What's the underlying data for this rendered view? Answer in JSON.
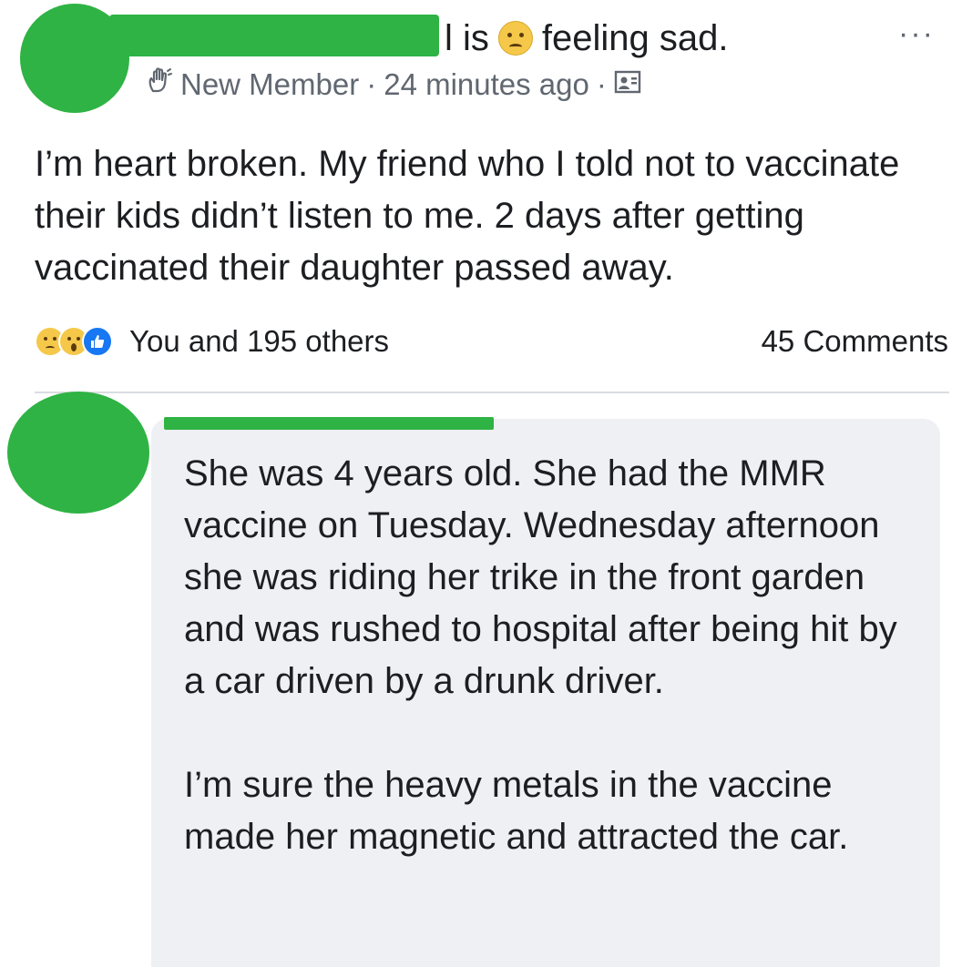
{
  "post": {
    "headline_verb": "l is",
    "feeling_text": "feeling sad.",
    "feeling_icon": "sad-face-emoji",
    "more_label": "···",
    "meta": {
      "group_icon": "waving-hand-icon",
      "member_badge": "New Member",
      "timestamp": "24 minutes ago",
      "privacy_icon": "group-privacy-icon",
      "separator": "·"
    },
    "body": "I’m heart broken. My friend who I told not to vaccinate their kids didn’t listen to me. 2 days after getting vaccinated their daughter passed away.",
    "reactions": {
      "icons": [
        "sad-reaction-icon",
        "wow-reaction-icon",
        "like-reaction-icon"
      ],
      "summary": "You and 195 others"
    },
    "comments_count": "45 Comments",
    "colors": {
      "redaction": "#2fb344",
      "like_blue": "#1877f2",
      "meta_gray": "#606770"
    }
  },
  "comment": {
    "text": "She was 4 years old. She had the MMR vaccine on Tuesday. Wednesday afternoon she was riding her trike in the front garden and was rushed to hospital after being hit by a car driven by a drunk driver.\n\nI’m sure the heavy metals in the vaccine made her magnetic and attracted the car.",
    "bubble_color": "#eef0f4"
  }
}
